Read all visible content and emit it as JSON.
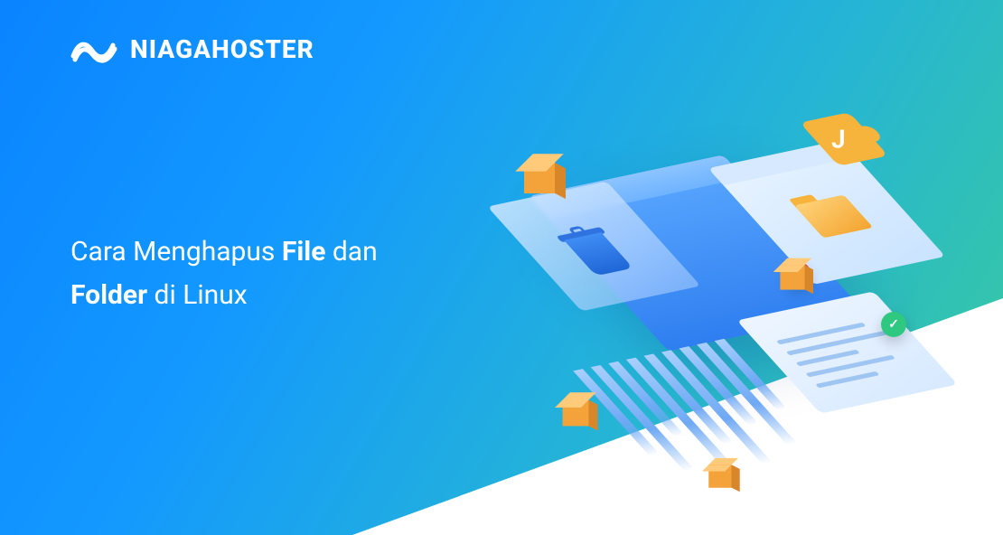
{
  "brand": {
    "name": "NIAGAHOSTER"
  },
  "headline": {
    "part1": "Cara Menghapus ",
    "bold1": "File",
    "part2": " dan ",
    "bold2": "Folder",
    "part3": " di Linux"
  },
  "icons": {
    "logo_mark": "infinity-wave-icon",
    "trash": "trash-icon",
    "folder": "folder-icon",
    "puzzle": "puzzle-piece-icon",
    "close": "✕",
    "check": "✓"
  }
}
